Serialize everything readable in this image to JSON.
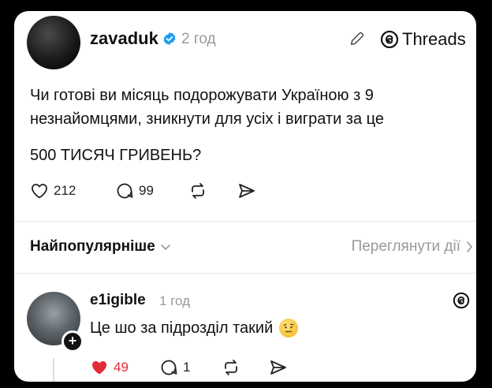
{
  "post": {
    "username": "zavaduk",
    "time": "2 год",
    "threads_label": "Threads",
    "text_line1": "Чи готові ви місяць подорожувати Україною з 9",
    "text_line2": "незнайомцями, зникнути для усіх і виграти за це",
    "text_line3": "500 ТИСЯЧ ГРИВЕНЬ?",
    "likes": "212",
    "comments": "99",
    "icons": [
      "verified-icon",
      "edit-icon",
      "threads-logo-icon",
      "heart-icon",
      "comment-icon",
      "repost-icon",
      "share-icon"
    ]
  },
  "sort": {
    "label": "Найпопулярніше",
    "activity_link": "Переглянути дії"
  },
  "reply": {
    "username": "e1igible",
    "time": "1 год",
    "text": "Це шо за підрозділ такий",
    "likes": "49",
    "comments": "1"
  },
  "colors": {
    "verified": "#1d9bf0",
    "liked": "#e22b38",
    "muted": "#999999"
  }
}
